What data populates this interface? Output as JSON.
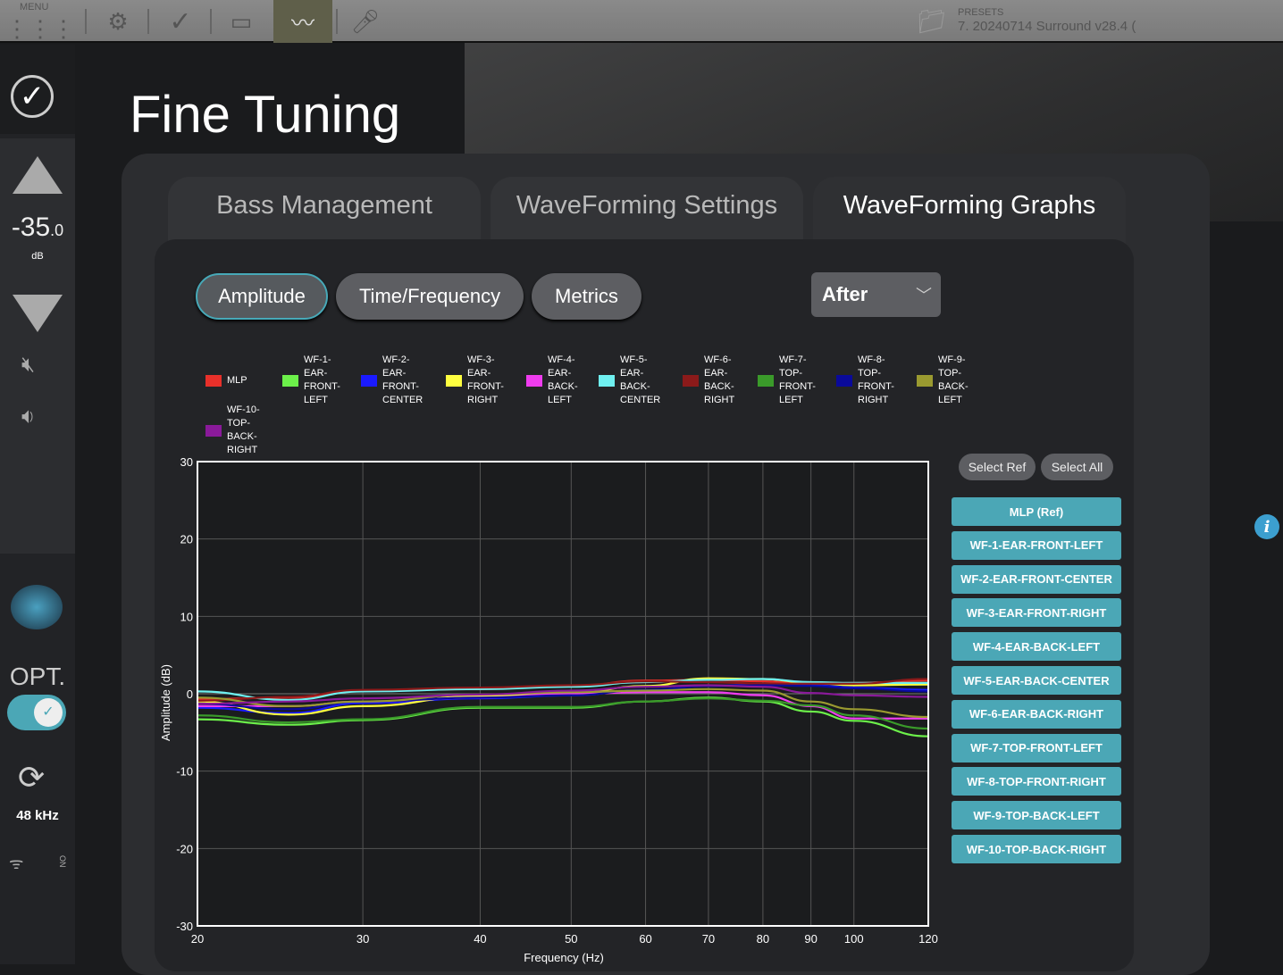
{
  "topbar": {
    "menu_label": "MENU",
    "presets_label": "PRESETS",
    "preset_value": "7. 20240714 Surround v28.4 ("
  },
  "sidebar": {
    "volume": "-35",
    "volume_decimal": ".0",
    "volume_unit": "dB",
    "input_label": "OPT.",
    "sample_rate": "48 kHz",
    "on_label": "ON"
  },
  "page_title": "Fine Tuning",
  "tabs": [
    {
      "label": "Bass Management"
    },
    {
      "label": "WaveForming Settings"
    },
    {
      "label": "WaveForming Graphs"
    }
  ],
  "subtabs": [
    {
      "label": "Amplitude"
    },
    {
      "label": "Time/Frequency"
    },
    {
      "label": "Metrics"
    }
  ],
  "view_select": "After",
  "select_ref": "Select Ref",
  "select_all": "Select All",
  "channel_buttons": [
    "MLP (Ref)",
    "WF-1-EAR-FRONT-LEFT",
    "WF-2-EAR-FRONT-CENTER",
    "WF-3-EAR-FRONT-RIGHT",
    "WF-4-EAR-BACK-LEFT",
    "WF-5-EAR-BACK-CENTER",
    "WF-6-EAR-BACK-RIGHT",
    "WF-7-TOP-FRONT-LEFT",
    "WF-8-TOP-FRONT-RIGHT",
    "WF-9-TOP-BACK-LEFT",
    "WF-10-TOP-BACK-RIGHT"
  ],
  "chart_data": {
    "type": "line",
    "xlabel": "Frequency (Hz)",
    "ylabel": "Amplitude (dB)",
    "xscale": "log",
    "xlim": [
      20,
      120
    ],
    "ylim": [
      -30,
      30
    ],
    "xticks": [
      20,
      30,
      40,
      50,
      60,
      70,
      80,
      90,
      100,
      120
    ],
    "yticks": [
      30,
      20,
      10,
      0,
      -10,
      -20,
      -30
    ],
    "grid": true,
    "legend": "top",
    "x": [
      20,
      25,
      30,
      40,
      50,
      60,
      70,
      80,
      90,
      100,
      120
    ],
    "series": [
      {
        "name": "MLP",
        "color": "#e8302a",
        "values": [
          -0.7,
          -0.5,
          0.4,
          0.6,
          1.0,
          1.7,
          1.8,
          1.6,
          1.3,
          1.4,
          1.7
        ]
      },
      {
        "name": "WF-1-EAR-FRONT-LEFT",
        "color": "#6cf04a",
        "values": [
          -3.3,
          -4.0,
          -3.4,
          -1.8,
          -1.8,
          -1.0,
          -0.5,
          -1.0,
          -2.3,
          -3.5,
          -5.5
        ]
      },
      {
        "name": "WF-2-EAR-FRONT-CENTER",
        "color": "#1a1aff",
        "values": [
          -1.8,
          -2.5,
          -1.2,
          -0.6,
          -0.2,
          0.5,
          1.0,
          1.2,
          1.1,
          0.8,
          0.5
        ]
      },
      {
        "name": "WF-3-EAR-FRONT-RIGHT",
        "color": "#ffff40",
        "values": [
          -1.0,
          -2.7,
          -1.6,
          -0.3,
          0.1,
          1.0,
          2.0,
          1.9,
          1.4,
          1.1,
          1.2
        ]
      },
      {
        "name": "WF-4-EAR-BACK-LEFT",
        "color": "#ef3cef",
        "values": [
          -1.6,
          -1.6,
          -1.0,
          -0.5,
          0.0,
          0.2,
          0.2,
          -0.2,
          -1.6,
          -3.2,
          -3.2
        ]
      },
      {
        "name": "WF-5-EAR-BACK-CENTER",
        "color": "#6ff0f0",
        "values": [
          0.3,
          -0.8,
          0.3,
          0.6,
          0.9,
          1.5,
          1.8,
          1.9,
          1.5,
          1.4,
          1.4
        ]
      },
      {
        "name": "WF-6-EAR-BACK-RIGHT",
        "color": "#8b1a1a",
        "values": [
          -0.9,
          -0.4,
          0.5,
          0.8,
          1.1,
          1.6,
          1.5,
          1.3,
          1.3,
          1.3,
          1.9
        ]
      },
      {
        "name": "WF-7-TOP-FRONT-LEFT",
        "color": "#3a9a2a",
        "values": [
          -2.8,
          -3.7,
          -3.3,
          -1.7,
          -1.7,
          -1.0,
          -0.6,
          -0.9,
          -1.5,
          -2.8,
          -4.5
        ]
      },
      {
        "name": "WF-8-TOP-FRONT-RIGHT",
        "color": "#0a0a9a",
        "values": [
          -1.3,
          -2.0,
          -1.0,
          -0.5,
          -0.2,
          0.5,
          1.0,
          1.1,
          1.0,
          0.7,
          0.3
        ]
      },
      {
        "name": "WF-9-TOP-BACK-LEFT",
        "color": "#9a9a30",
        "values": [
          -0.5,
          -1.6,
          -1.0,
          -0.1,
          0.2,
          0.4,
          0.6,
          0.4,
          -1.0,
          -2.0,
          -3.0
        ]
      },
      {
        "name": "WF-10-TOP-BACK-RIGHT",
        "color": "#8a1a9a",
        "values": [
          -1.3,
          -1.0,
          -0.6,
          -0.1,
          0.4,
          0.9,
          1.1,
          0.9,
          0.1,
          -0.2,
          -0.4
        ]
      }
    ],
    "legend_labels": [
      "MLP",
      "WF-1-EAR-FRONT-LEFT",
      "WF-2-EAR-FRONT-CENTER",
      "WF-3-EAR-FRONT-RIGHT",
      "WF-4-EAR-BACK-LEFT",
      "WF-5-EAR-BACK-CENTER",
      "WF-6-EAR-BACK-RIGHT",
      "WF-7-TOP-FRONT-LEFT",
      "WF-8-TOP-FRONT-RIGHT",
      "WF-9-TOP-BACK-LEFT",
      "WF-10-TOP-BACK-RIGHT"
    ]
  }
}
